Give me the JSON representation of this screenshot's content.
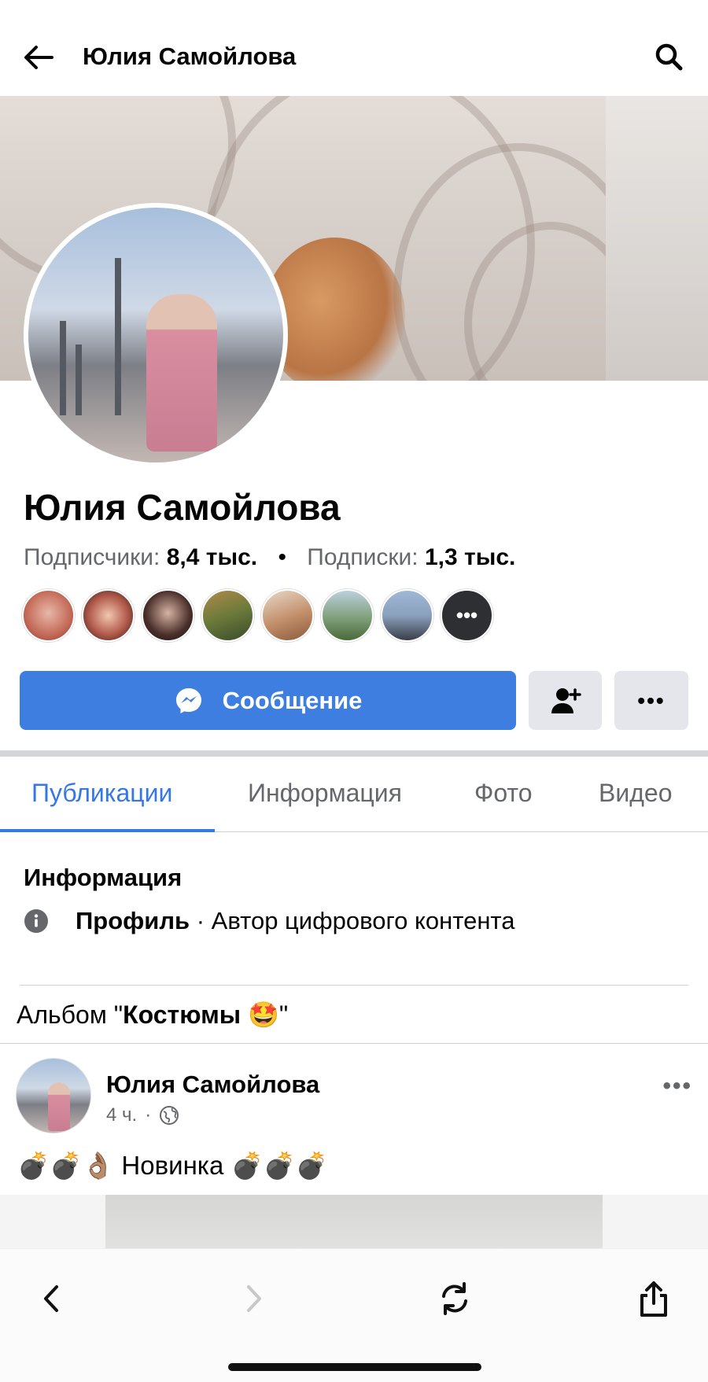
{
  "header": {
    "back_icon": "arrow-left-icon",
    "title": "Юлия Самойлова",
    "search_icon": "search-icon"
  },
  "profile": {
    "name": "Юлия Самойлова",
    "followers_label": "Подписчики:",
    "followers_value": "8,4 тыс.",
    "separator": "•",
    "following_label": "Подписки:",
    "following_value": "1,3 тыс.",
    "friends_more_label": "•••"
  },
  "actions": {
    "message_label": "Сообщение",
    "message_icon": "messenger-icon",
    "add_friend_icon": "add-friend-icon",
    "more_label": "•••"
  },
  "tabs": [
    {
      "label": "Публикации",
      "active": true
    },
    {
      "label": "Информация",
      "active": false
    },
    {
      "label": "Фото",
      "active": false
    },
    {
      "label": "Видео",
      "active": false
    }
  ],
  "info": {
    "title": "Информация",
    "icon": "info-icon",
    "type_label": "Профиль",
    "type_rest": " · Автор цифрового контента"
  },
  "album": {
    "prefix": "Альбом \"",
    "name": "Костюмы",
    "emoji": "🤩",
    "suffix": "\""
  },
  "post": {
    "author": "Юлия Самойлова",
    "time": "4 ч.",
    "dot": "·",
    "text": "💣💣👌🏽 Новинка 💣💣💣",
    "more_label": "•••"
  },
  "browser": {
    "back_icon": "chevron-left-icon",
    "forward_icon": "chevron-right-icon",
    "reload_icon": "reload-icon",
    "share_icon": "share-icon"
  },
  "colors": {
    "accent": "#3578e5",
    "button_blue": "#3d7ee0",
    "secondary_button": "#e4e6eb",
    "muted_text": "#65676b"
  }
}
